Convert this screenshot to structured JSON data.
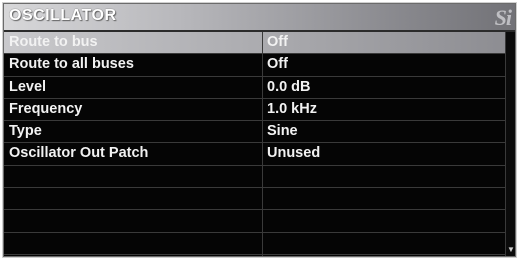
{
  "panel": {
    "title": "OSCILLATOR",
    "logo": "Si"
  },
  "rows": [
    {
      "label": "Route to bus",
      "value": "Off",
      "selected": true
    },
    {
      "label": "Route to all buses",
      "value": "Off"
    },
    {
      "label": "Level",
      "value": "0.0 dB"
    },
    {
      "label": "Frequency",
      "value": "1.0 kHz"
    },
    {
      "label": "Type",
      "value": "Sine"
    },
    {
      "label": "Oscillator Out Patch",
      "value": "Unused"
    },
    {
      "label": "",
      "value": ""
    },
    {
      "label": "",
      "value": ""
    },
    {
      "label": "",
      "value": ""
    },
    {
      "label": "",
      "value": ""
    }
  ],
  "scrollbar": {
    "down_arrow_icon": "triangle-down-icon",
    "down_arrow_glyph": "▼"
  },
  "colors": {
    "background": "#050505",
    "header_gradient_start": "#d7d7d9",
    "header_gradient_end": "#727277",
    "selected_row": "#a9a9ad",
    "text": "#f2f2f2"
  }
}
